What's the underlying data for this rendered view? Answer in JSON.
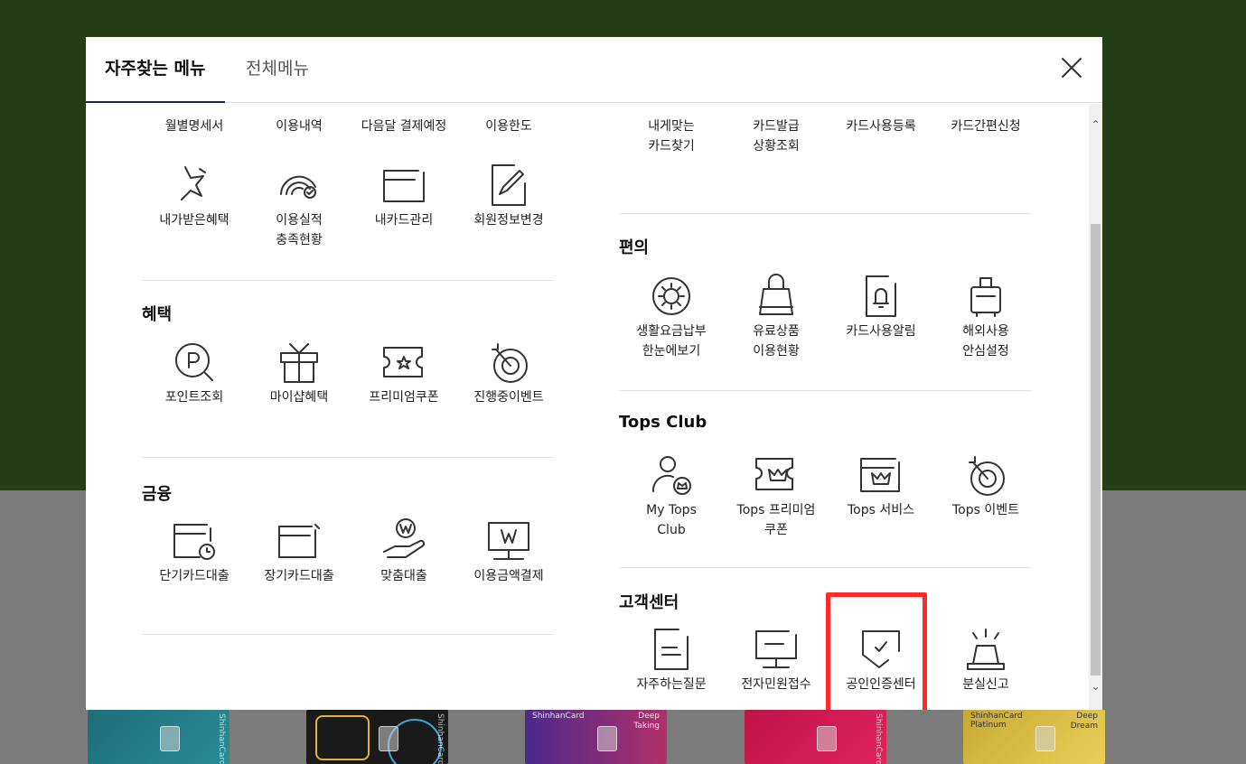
{
  "tabs": {
    "favorites": "자주찾는 메뉴",
    "all_menu": "전체메뉴"
  },
  "left": {
    "top_items": [
      "월별명세서",
      "이용내역",
      "다음달 결제예정",
      "이용한도"
    ],
    "row2": [
      {
        "label": "내가받은혜택",
        "icon": "star-hand-icon"
      },
      {
        "label": "이용실적\n충족현황",
        "icon": "gauge-check-icon"
      },
      {
        "label": "내카드관리",
        "icon": "card-folder-icon"
      },
      {
        "label": "회원정보변경",
        "icon": "document-edit-icon"
      }
    ],
    "benefit": {
      "title": "혜택",
      "items": [
        {
          "label": "포인트조회",
          "icon": "point-search-icon"
        },
        {
          "label": "마이샵혜택",
          "icon": "gift-box-icon"
        },
        {
          "label": "프리미엄쿠폰",
          "icon": "coupon-star-icon"
        },
        {
          "label": "진행중이벤트",
          "icon": "target-dart-icon"
        }
      ]
    },
    "finance": {
      "title": "금융",
      "items": [
        {
          "label": "단기카드대출",
          "icon": "folder-clock-icon"
        },
        {
          "label": "장기카드대출",
          "icon": "folder-arrow-icon"
        },
        {
          "label": "맞춤대출",
          "icon": "hand-won-icon"
        },
        {
          "label": "이용금액결제",
          "icon": "monitor-won-icon"
        }
      ]
    }
  },
  "right": {
    "top_items": [
      "내게맞는\n카드찾기",
      "카드발급\n상황조회",
      "카드사용등록",
      "카드간편신청"
    ],
    "convenience": {
      "title": "편의",
      "items": [
        {
          "label": "생활요금납부\n한눈에보기",
          "icon": "gear-sun-icon"
        },
        {
          "label": "유료상품\n이용현황",
          "icon": "shopping-bag-icon"
        },
        {
          "label": "카드사용알림",
          "icon": "bell-document-icon"
        },
        {
          "label": "해외사용\n안심설정",
          "icon": "luggage-icon"
        }
      ]
    },
    "tops": {
      "title": "Tops Club",
      "items": [
        {
          "label": "My Tops\nClub",
          "icon": "user-crown-icon"
        },
        {
          "label": "Tops 프리미엄\n쿠폰",
          "icon": "coupon-crown-icon"
        },
        {
          "label": "Tops 서비스",
          "icon": "folder-crown-icon"
        },
        {
          "label": "Tops 이벤트",
          "icon": "target-dart-icon"
        }
      ]
    },
    "customer": {
      "title": "고객센터",
      "items": [
        {
          "label": "자주하는질문",
          "icon": "document-lines-icon"
        },
        {
          "label": "전자민원접수",
          "icon": "monitor-dash-icon"
        },
        {
          "label": "공인인증센터",
          "icon": "shield-check-icon"
        },
        {
          "label": "분실신고",
          "icon": "siren-icon"
        }
      ]
    }
  },
  "cards_strip": {
    "brand": "ShinhanCard",
    "card3_name": "Deep\nTaking",
    "card5_brand": "ShinhanCard\nPlatinum",
    "card5_name": "Deep\nDream"
  },
  "colors": {
    "background_top": "#243f18",
    "highlight": "#ff2a2a",
    "tab_underline": "#1b2a4a"
  }
}
